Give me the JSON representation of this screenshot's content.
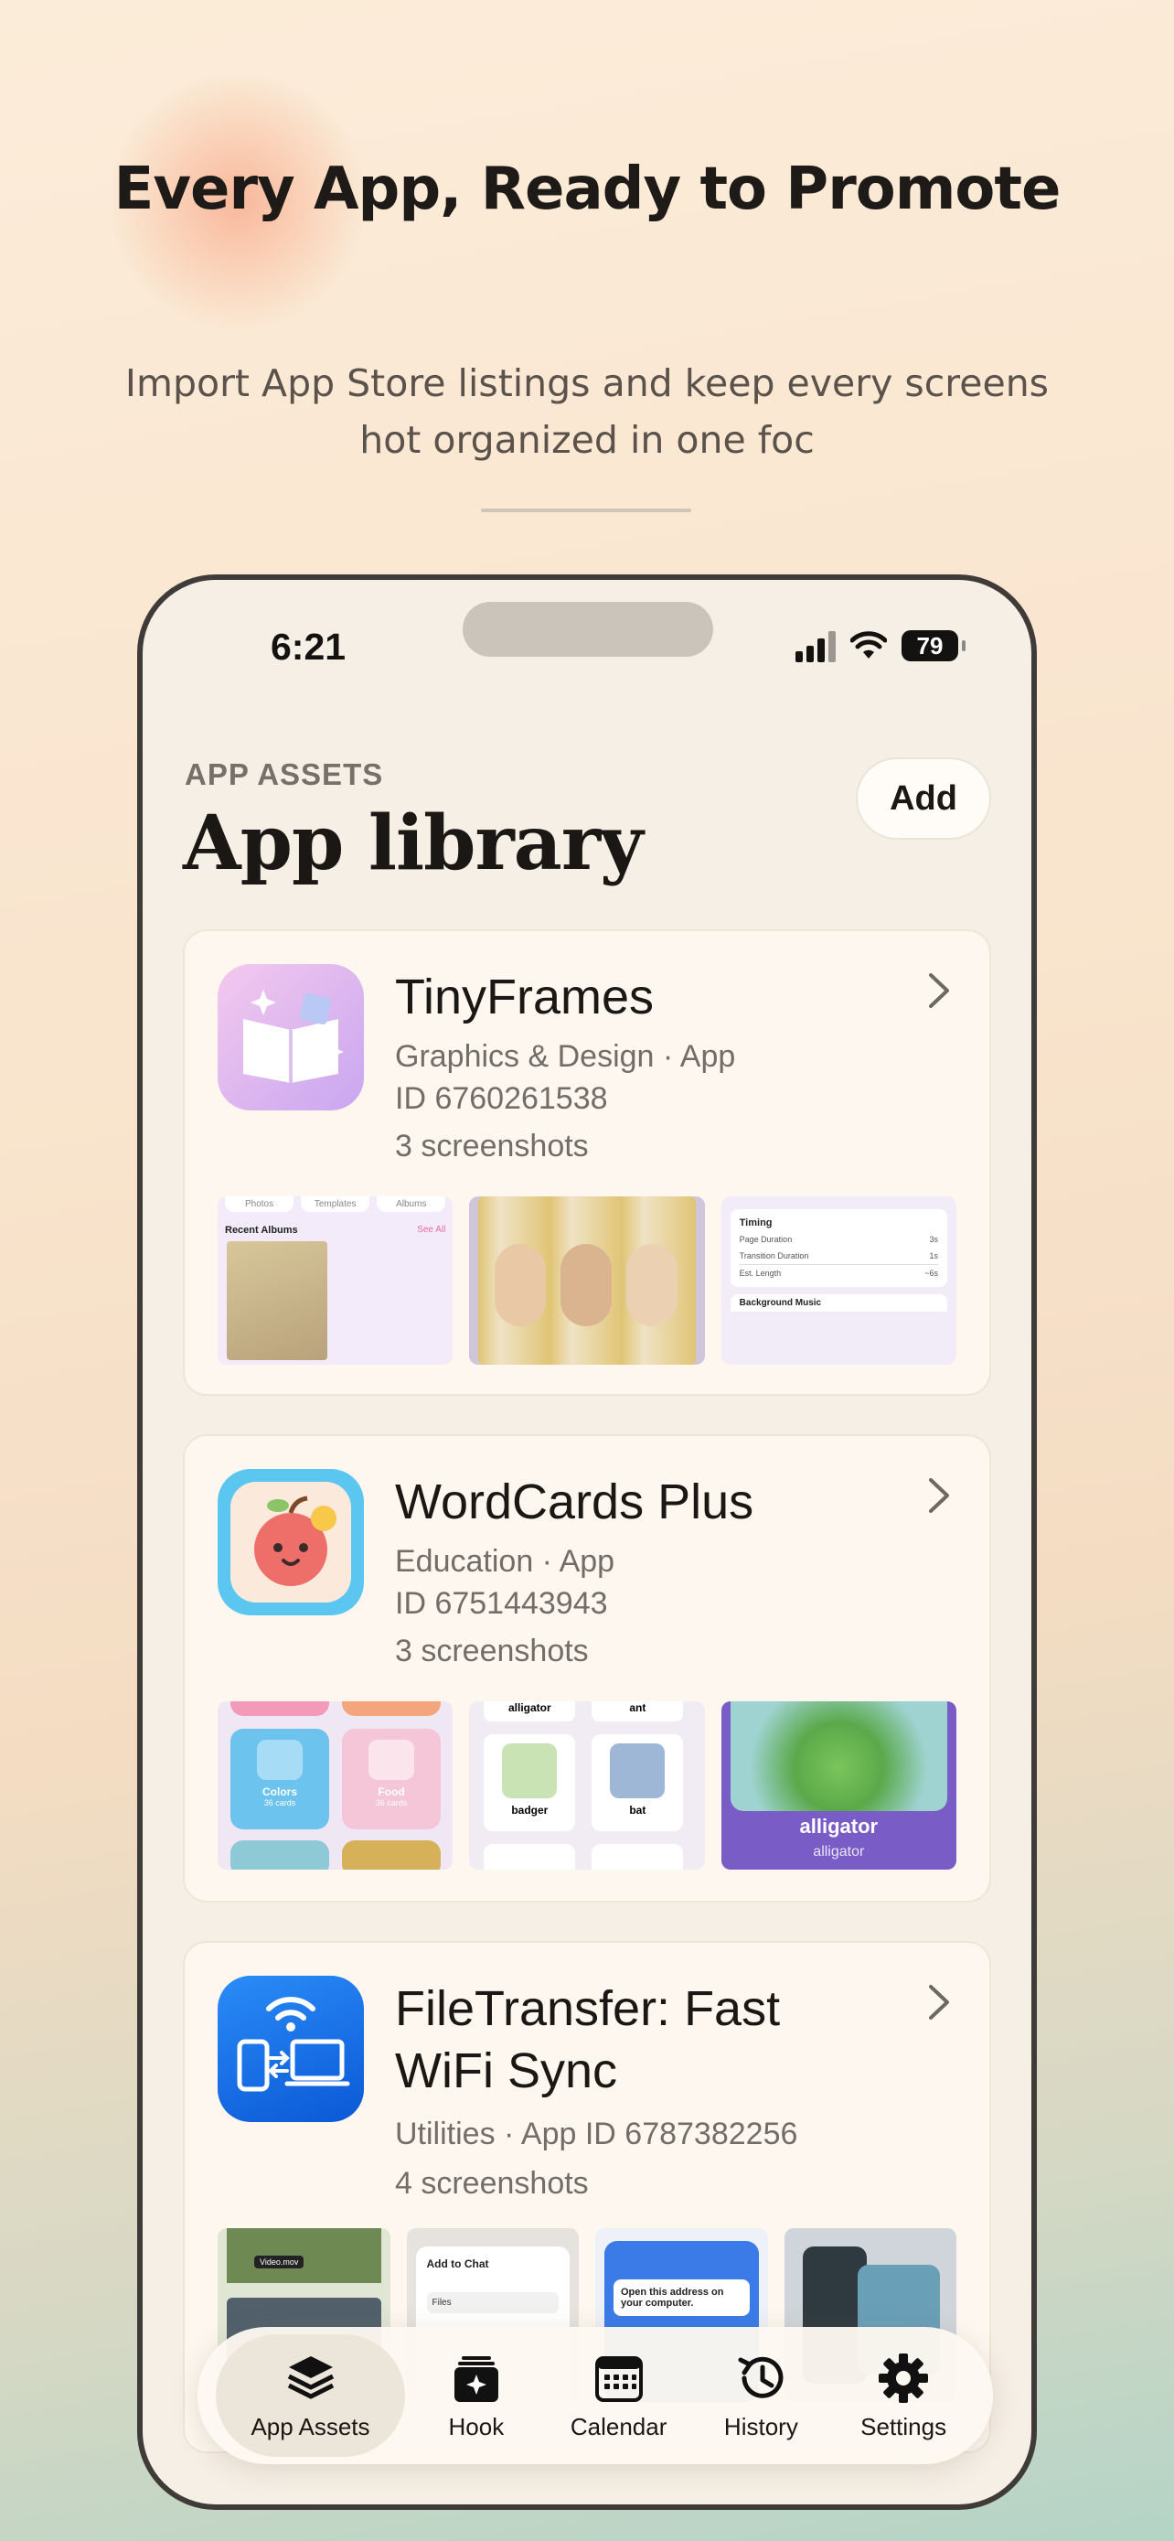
{
  "marketing": {
    "headline": "Every App, Ready to Promote",
    "subline": "Import App Store listings and keep every screens hot organized in one foc"
  },
  "status_bar": {
    "time": "6:21",
    "battery": "79"
  },
  "header": {
    "eyebrow": "APP ASSETS",
    "title": "App library",
    "add_label": "Add"
  },
  "apps": [
    {
      "name": "TinyFrames",
      "category_line1": "Graphics & Design · App",
      "category_line2": "ID 6760261538",
      "screenshots": "3 screenshots",
      "shot_texts": {
        "tab1": "Photos",
        "tab2": "Templates",
        "tab3": "Albums",
        "recent": "Recent Albums",
        "see_all": "See All",
        "timing": "Timing",
        "page_duration": "Page Duration",
        "page_value": "3s",
        "transition_duration": "Transition Duration",
        "transition_value": "1s",
        "est_length": "Est. Length",
        "est_value": "~6s",
        "background_music": "Background Music"
      }
    },
    {
      "name": "WordCards Plus",
      "category_line1": "Education · App",
      "category_line2": "ID 6751443943",
      "screenshots": "3 screenshots",
      "shot_texts": {
        "colors": "Colors",
        "colors_count": "36 cards",
        "food": "Food",
        "food_count": "36 cards",
        "alligator": "alligator",
        "ant": "ant",
        "badger": "badger",
        "bat": "bat",
        "hero_word": "alligator",
        "hero_sub": "alligator"
      }
    },
    {
      "name": "FileTransfer: Fast WiFi Sync",
      "category_line1": "Utilities · App ID 6787382256",
      "screenshots": "4 screenshots",
      "shot_texts": {
        "video_row": "Video.mov",
        "add_to_chat": "Add to Chat",
        "files": "Files",
        "open_address": "Open this address on your computer."
      }
    }
  ],
  "tabbar": {
    "items": [
      {
        "label": "App Assets",
        "icon": "stack-icon",
        "active": true
      },
      {
        "label": "Hook",
        "icon": "sparkle-card-icon"
      },
      {
        "label": "Calendar",
        "icon": "calendar-icon"
      },
      {
        "label": "History",
        "icon": "history-icon"
      },
      {
        "label": "Settings",
        "icon": "gear-icon"
      }
    ]
  }
}
